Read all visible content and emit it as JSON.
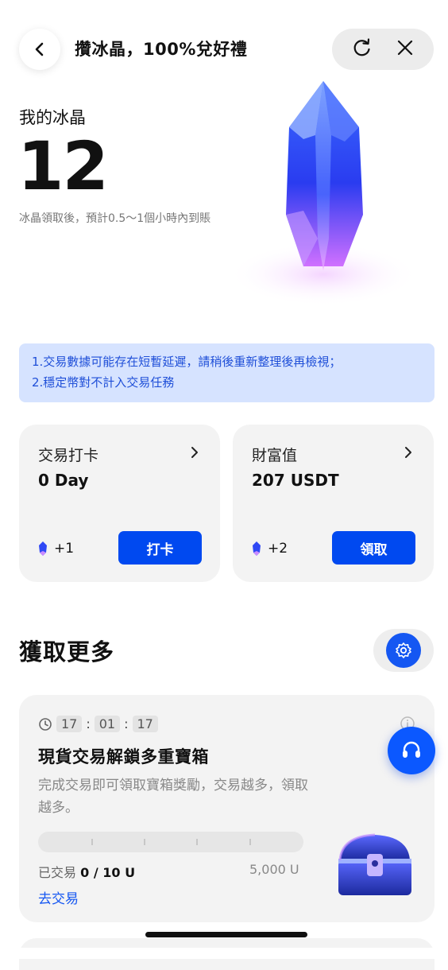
{
  "header": {
    "title": "攢冰晶，100%兌好禮",
    "back_icon": "chevron-left-icon",
    "refresh_icon": "refresh-icon",
    "close_icon": "close-icon"
  },
  "hero": {
    "label": "我的冰晶",
    "count": "12",
    "note": "冰晶領取後，預計0.5～1個小時內到賬"
  },
  "notice": {
    "line1": "1.交易數據可能存在短暫延遲，請稍後重新整理後再檢視；",
    "line2": "2.穩定幣對不計入交易任務"
  },
  "cards": [
    {
      "title": "交易打卡",
      "value": "0 Day",
      "reward": "+1",
      "button": "打卡"
    },
    {
      "title": "財富值",
      "value": "207 USDT",
      "reward": "+2",
      "button": "領取"
    }
  ],
  "section": {
    "title": "獲取更多"
  },
  "task": {
    "timer": {
      "h": "17",
      "m": "01",
      "s": "17"
    },
    "title": "現貨交易解鎖多重寶箱",
    "description": "完成交易即可領取寶箱獎勵，交易越多，領取越多。",
    "traded_label": "已交易",
    "traded_value": "0 / 10 U",
    "target": "5,000 U",
    "progress": 0,
    "action": "去交易"
  },
  "colors": {
    "accent": "#0049f0",
    "notice_bg": "#d6e3ff",
    "notice_text": "#1f4fd8"
  }
}
